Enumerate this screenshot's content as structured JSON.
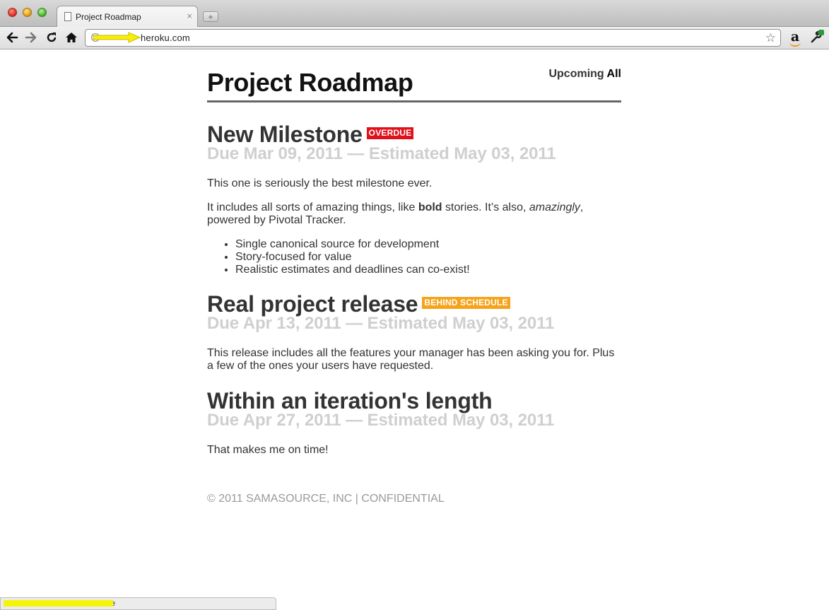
{
  "browser": {
    "tab_title": "Project Roadmap",
    "tab_close": "×",
    "new_tab": "+",
    "url": "heroku.com",
    "status_text": "e",
    "icons": {
      "back": "back-arrow-icon",
      "forward": "forward-arrow-icon",
      "reload": "reload-icon",
      "home": "home-icon",
      "star": "bookmark-star-icon",
      "amazon": "amazon-extension-icon",
      "wrench": "wrench-menu-icon"
    }
  },
  "header": {
    "title": "Project Roadmap",
    "nav": {
      "upcoming": "Upcoming",
      "all": "All"
    }
  },
  "milestones": [
    {
      "title": "New Milestone",
      "badge": "OVERDUE",
      "badge_color": "#e0101b",
      "dates": "Due Mar 09, 2011 — Estimated May 03, 2011",
      "paragraphs": [
        "This one is seriously the best milestone ever."
      ],
      "rich": {
        "before": "It includes all sorts of amazing things, like ",
        "bold": "bold",
        "middle": " stories. It’s also, ",
        "italic": "amazingly",
        "after": ", powered by Pivotal Tracker."
      },
      "list": [
        "Single canonical source for development",
        "Story-focused for value",
        "Realistic estimates and deadlines can co-exist!"
      ]
    },
    {
      "title": "Real project release",
      "badge": "BEHIND SCHEDULE",
      "badge_color": "#f6a21a",
      "dates": "Due Apr 13, 2011 — Estimated May 03, 2011",
      "paragraphs": [
        "This release includes all the features your manager has been asking you for. Plus a few of the ones your users have requested."
      ]
    },
    {
      "title": "Within an iteration's length",
      "dates": "Due Apr 27, 2011 — Estimated May 03, 2011",
      "paragraphs": [
        "That makes me on time!"
      ]
    }
  ],
  "footer": {
    "text": "© 2011 SAMASOURCE, INC | CONFIDENTIAL"
  }
}
